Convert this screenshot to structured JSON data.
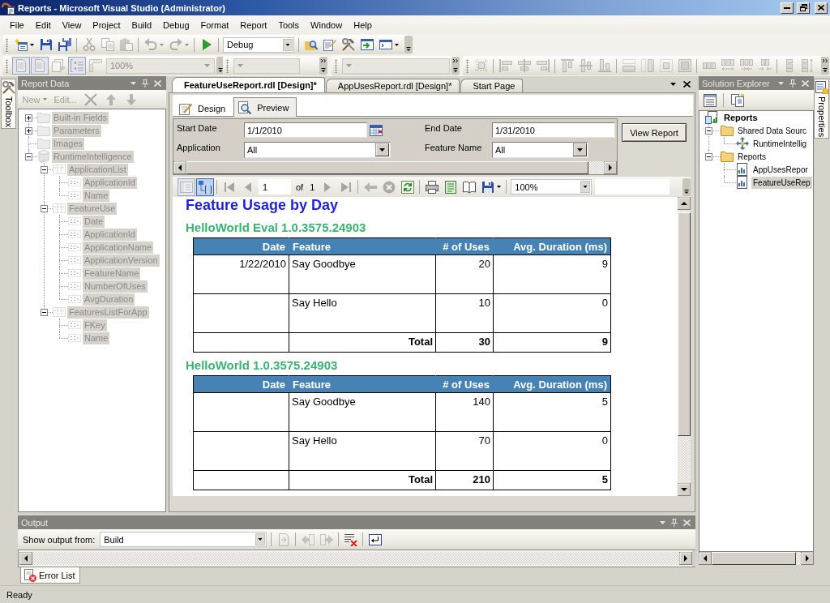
{
  "window": {
    "title": "Reports - Microsoft Visual Studio (Administrator)"
  },
  "menu": [
    "File",
    "Edit",
    "View",
    "Project",
    "Build",
    "Debug",
    "Format",
    "Report",
    "Tools",
    "Window",
    "Help"
  ],
  "toolbar_rows": [
    [
      {
        "has_hidden_items": false,
        "items": [
          {
            "kind": "button",
            "disabled": false,
            "dropdown": true
          },
          {
            "kind": "button",
            "disabled": false,
            "dropdown": false
          },
          {
            "kind": "button",
            "disabled": false,
            "dropdown": false
          },
          {
            "kind": "separator"
          },
          {
            "kind": "button",
            "disabled": true,
            "dropdown": false
          },
          {
            "kind": "button",
            "disabled": true,
            "dropdown": false
          },
          {
            "kind": "button",
            "disabled": true,
            "dropdown": false
          },
          {
            "kind": "separator"
          },
          {
            "kind": "button",
            "disabled": true,
            "dropdown": true
          },
          {
            "kind": "button",
            "disabled": true,
            "dropdown": true
          },
          {
            "kind": "separator"
          },
          {
            "kind": "button",
            "disabled": false,
            "dropdown": false
          },
          {
            "kind": "separator"
          },
          {
            "kind": "select",
            "value": "Debug",
            "disabled": false
          },
          {
            "kind": "separator"
          },
          {
            "kind": "button",
            "disabled": false,
            "dropdown": false
          },
          {
            "kind": "button",
            "disabled": false,
            "dropdown": false
          },
          {
            "kind": "button",
            "disabled": false,
            "dropdown": false
          },
          {
            "kind": "button",
            "disabled": false,
            "dropdown": false
          },
          {
            "kind": "button",
            "disabled": false,
            "dropdown": true
          }
        ]
      }
    ],
    [
      {
        "has_hidden_items": false,
        "items": [
          {
            "kind": "button",
            "disabled": true,
            "pressed": true
          },
          {
            "kind": "button",
            "disabled": true,
            "pressed": true
          },
          {
            "kind": "button",
            "disabled": true,
            "pressed": false
          },
          {
            "kind": "button",
            "disabled": true,
            "pressed": true
          },
          {
            "kind": "button",
            "disabled": true,
            "pressed": false
          },
          {
            "kind": "select",
            "value": "100%",
            "disabled": true
          }
        ]
      },
      {
        "has_hidden_items": true,
        "items": [
          {
            "kind": "select",
            "disabled": true
          }
        ]
      },
      {
        "has_hidden_items": true,
        "items": [
          {
            "kind": "select",
            "disabled": true
          }
        ]
      },
      {
        "has_hidden_items": true,
        "items": [
          {
            "kind": "button",
            "disabled": true
          },
          {
            "kind": "separator"
          },
          {
            "kind": "button",
            "disabled": true
          },
          {
            "kind": "button",
            "disabled": true
          },
          {
            "kind": "button",
            "disabled": true
          },
          {
            "kind": "separator"
          },
          {
            "kind": "button",
            "disabled": true
          },
          {
            "kind": "button",
            "disabled": true
          },
          {
            "kind": "button",
            "disabled": true
          },
          {
            "kind": "separator"
          },
          {
            "kind": "button",
            "disabled": true
          },
          {
            "kind": "button",
            "disabled": true
          },
          {
            "kind": "button",
            "disabled": true
          },
          {
            "kind": "button",
            "disabled": true
          },
          {
            "kind": "separator"
          },
          {
            "kind": "button",
            "disabled": true
          },
          {
            "kind": "button",
            "disabled": true
          },
          {
            "kind": "button",
            "disabled": true
          },
          {
            "kind": "button",
            "disabled": true
          },
          {
            "kind": "separator"
          },
          {
            "kind": "button",
            "disabled": true
          },
          {
            "kind": "button",
            "disabled": true
          }
        ]
      }
    ]
  ],
  "toolbox_tab": {
    "label": "Toolbox"
  },
  "report_data": {
    "title": "Report Data",
    "disabled": true,
    "toolbar": {
      "items": [
        {
          "kind": "button",
          "label": "New",
          "disabled": true,
          "dropdown": true
        },
        {
          "kind": "button",
          "label": "Edit...",
          "disabled": true,
          "dropdown": false
        },
        {
          "kind": "button",
          "disabled": true,
          "dropdown": false
        },
        {
          "kind": "button",
          "disabled": true,
          "dropdown": false
        },
        {
          "kind": "button",
          "disabled": true,
          "dropdown": false
        }
      ]
    },
    "tree": [
      {
        "label": "Built-in Fields",
        "kind": "folder",
        "expanded": false
      },
      {
        "label": "Parameters",
        "kind": "folder",
        "expanded": false
      },
      {
        "label": "Images",
        "kind": "folder"
      },
      {
        "label": "RuntimeIntelligence",
        "kind": "database",
        "expanded": true,
        "children": [
          {
            "label": "ApplicationList",
            "kind": "dataset",
            "expanded": true,
            "children": [
              {
                "label": "ApplicationId",
                "kind": "field"
              },
              {
                "label": "Name",
                "kind": "field"
              }
            ]
          },
          {
            "label": "FeatureUse",
            "kind": "dataset",
            "expanded": true,
            "children": [
              {
                "label": "Date",
                "kind": "field"
              },
              {
                "label": "ApplicationId",
                "kind": "field"
              },
              {
                "label": "ApplicationName",
                "kind": "field"
              },
              {
                "label": "ApplicationVersion",
                "kind": "field"
              },
              {
                "label": "FeatureName",
                "kind": "field"
              },
              {
                "label": "NumberOfUses",
                "kind": "field"
              },
              {
                "label": "AvgDuration",
                "kind": "field"
              }
            ]
          },
          {
            "label": "FeaturesListForApp",
            "kind": "dataset",
            "expanded": true,
            "children": [
              {
                "label": "FKey",
                "kind": "field"
              },
              {
                "label": "Name",
                "kind": "field"
              }
            ]
          }
        ]
      }
    ]
  },
  "document_tabs": [
    {
      "label": "FeatureUseReport.rdl [Design]*",
      "selected": true
    },
    {
      "label": "AppUsesReport.rdl [Design]*",
      "selected": false
    },
    {
      "label": "Start Page",
      "selected": false
    }
  ],
  "view_tabs": [
    {
      "label": "Design",
      "selected": false
    },
    {
      "label": "Preview",
      "selected": true
    }
  ],
  "parameters": [
    {
      "label": "Start Date",
      "kind": "date",
      "value": "1/1/2010"
    },
    {
      "label": "End Date",
      "kind": "date",
      "value": "1/31/2010"
    },
    {
      "label": "Application",
      "kind": "select",
      "value": "All"
    },
    {
      "label": "Feature Name",
      "kind": "select",
      "value": "All"
    }
  ],
  "view_report_button": "View Report",
  "report_toolbar": {
    "has_hidden_items": false,
    "items": [
      {
        "kind": "button",
        "disabled": true,
        "pressed": true,
        "dropdown": false
      },
      {
        "kind": "button",
        "disabled": false,
        "pressed": true,
        "dropdown": false
      },
      {
        "kind": "separator"
      },
      {
        "kind": "button",
        "disabled": true,
        "pressed": false,
        "dropdown": false
      },
      {
        "kind": "button",
        "disabled": true,
        "pressed": false,
        "dropdown": false
      },
      {
        "kind": "field",
        "value": "1"
      },
      {
        "kind": "label",
        "text": "of"
      },
      {
        "kind": "label",
        "text": "1"
      },
      {
        "kind": "button",
        "disabled": true,
        "pressed": false,
        "dropdown": false
      },
      {
        "kind": "button",
        "disabled": true,
        "pressed": false,
        "dropdown": false
      },
      {
        "kind": "separator"
      },
      {
        "kind": "button",
        "disabled": true,
        "pressed": false,
        "dropdown": false
      },
      {
        "kind": "button",
        "disabled": true,
        "pressed": false,
        "dropdown": false
      },
      {
        "kind": "button",
        "disabled": false,
        "pressed": false,
        "dropdown": false
      },
      {
        "kind": "separator"
      },
      {
        "kind": "button",
        "disabled": false,
        "pressed": false,
        "dropdown": false
      },
      {
        "kind": "button",
        "disabled": false,
        "pressed": false,
        "dropdown": false
      },
      {
        "kind": "button",
        "disabled": false,
        "pressed": false,
        "dropdown": false
      },
      {
        "kind": "button",
        "disabled": false,
        "pressed": false,
        "dropdown": true
      },
      {
        "kind": "separator"
      },
      {
        "kind": "select",
        "value": "100%",
        "disabled": false
      },
      {
        "kind": "field"
      }
    ]
  },
  "report": {
    "title": "Feature Usage by Day",
    "groups": [
      {
        "title": "HelloWorld Eval 1.0.3575.24903",
        "columns": [
          "Date",
          "Feature",
          "# of Uses",
          "Avg. Duration (ms)"
        ],
        "rows": [
          {
            "date": "1/22/2010",
            "feature": "Say Goodbye",
            "uses": "20",
            "avg_duration": "9"
          },
          {
            "feature": "Say Hello",
            "uses": "10",
            "avg_duration": "0"
          }
        ],
        "total": {
          "label": "Total",
          "uses": "30",
          "avg_duration": "9"
        }
      },
      {
        "title": "HelloWorld 1.0.3575.24903",
        "columns": [
          "Date",
          "Feature",
          "# of Uses",
          "Avg. Duration (ms)"
        ],
        "rows": [
          {
            "feature": "Say Goodbye",
            "uses": "140",
            "avg_duration": "5"
          },
          {
            "feature": "Say Hello",
            "uses": "70",
            "avg_duration": "0"
          }
        ],
        "total": {
          "label": "Total",
          "uses": "210",
          "avg_duration": "5"
        }
      }
    ]
  },
  "solution_explorer": {
    "title": "Solution Explorer",
    "tree": [
      {
        "label": "Reports",
        "kind": "solution",
        "selected": false,
        "children": [
          {
            "label": "Shared Data Sourc",
            "kind": "folder",
            "expanded": true,
            "selected": false,
            "children": [
              {
                "label": "RuntimeIntellig",
                "kind": "datasource",
                "selected": false
              }
            ]
          },
          {
            "label": "Reports",
            "kind": "folder",
            "expanded": true,
            "selected": false,
            "children": [
              {
                "label": "AppUsesRepor",
                "kind": "report",
                "selected": false
              },
              {
                "label": "FeatureUseRep",
                "kind": "report",
                "selected": true
              }
            ]
          }
        ]
      }
    ]
  },
  "properties_tab": {
    "label": "Properties"
  },
  "output": {
    "title": "Output",
    "toolbar": {
      "items": [
        {
          "kind": "label",
          "text": "Show output from:"
        },
        {
          "kind": "select",
          "value": "Build",
          "disabled": false
        },
        {
          "kind": "separator"
        },
        {
          "kind": "button",
          "disabled": true
        },
        {
          "kind": "separator"
        },
        {
          "kind": "button",
          "disabled": true
        },
        {
          "kind": "button",
          "disabled": true
        },
        {
          "kind": "separator"
        },
        {
          "kind": "button",
          "disabled": false
        },
        {
          "kind": "separator"
        },
        {
          "kind": "button",
          "disabled": false
        }
      ]
    }
  },
  "bottom_tabs": [
    {
      "label": "Error List"
    }
  ],
  "status_bar": {
    "text": "Ready"
  }
}
